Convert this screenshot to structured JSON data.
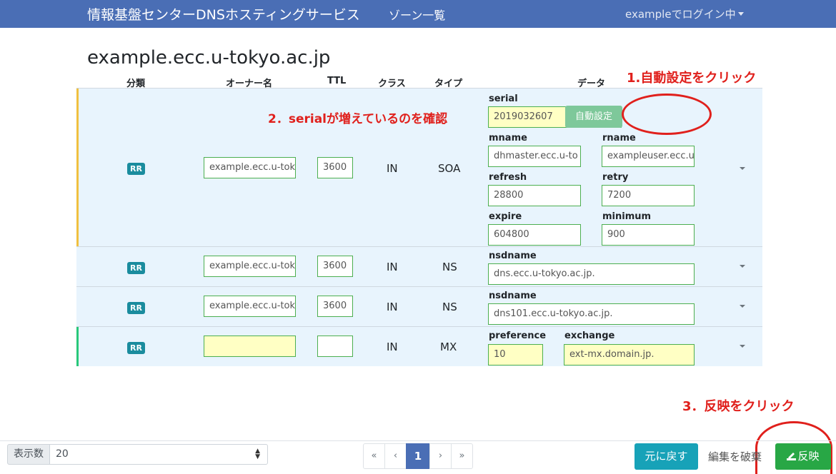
{
  "navbar": {
    "brand": "情報基盤センターDNSホスティングサービス",
    "zone_list": "ゾーン一覧",
    "login": "exampleでログイン中"
  },
  "zone": {
    "title": "example.ecc.u-tokyo.ac.jp"
  },
  "table": {
    "headers": {
      "category": "分類",
      "owner": "オーナー名",
      "ttl": "TTL",
      "class": "クラス",
      "type": "タイプ",
      "data": "データ"
    },
    "badge": "RR",
    "soa": {
      "owner": "example.ecc.u-tok",
      "ttl": "3600",
      "class": "IN",
      "type": "SOA",
      "labels": {
        "serial": "serial",
        "mname": "mname",
        "rname": "rname",
        "refresh": "refresh",
        "retry": "retry",
        "expire": "expire",
        "minimum": "minimum"
      },
      "serial": "2019032607",
      "mname": "dhmaster.ecc.u-to",
      "rname": "exampleuser.ecc.u",
      "refresh": "28800",
      "retry": "7200",
      "expire": "604800",
      "minimum": "900",
      "auto_button": "自動設定"
    },
    "ns1": {
      "owner": "example.ecc.u-tok",
      "ttl": "3600",
      "class": "IN",
      "type": "NS",
      "label": "nsdname",
      "value": "dns.ecc.u-tokyo.ac.jp."
    },
    "ns2": {
      "owner": "example.ecc.u-tok",
      "ttl": "3600",
      "class": "IN",
      "type": "NS",
      "label": "nsdname",
      "value": "dns101.ecc.u-tokyo.ac.jp."
    },
    "mx": {
      "owner": "",
      "ttl": "",
      "class": "IN",
      "type": "MX",
      "pref_label": "preference",
      "exch_label": "exchange",
      "preference": "10",
      "exchange": "ext-mx.domain.jp."
    }
  },
  "annotations": {
    "step1": "1.自動設定をクリック",
    "step2": "2．serialが増えているのを確認",
    "step3": "3．反映をクリック"
  },
  "footer": {
    "per_page_label": "表示数",
    "per_page_value": "20",
    "pager": [
      "«",
      "‹",
      "1",
      "›",
      "»"
    ],
    "revert": "元に戻す",
    "discard": "編集を破棄",
    "apply": "反映"
  },
  "colors": {
    "navbar": "#4a6eb5",
    "row_bg": "#e8f4fd",
    "soa_bar": "#f0c040",
    "mx_bar": "#28c87a",
    "annotation": "#e0201c",
    "apply": "#28a745",
    "revert": "#17a2b8"
  }
}
